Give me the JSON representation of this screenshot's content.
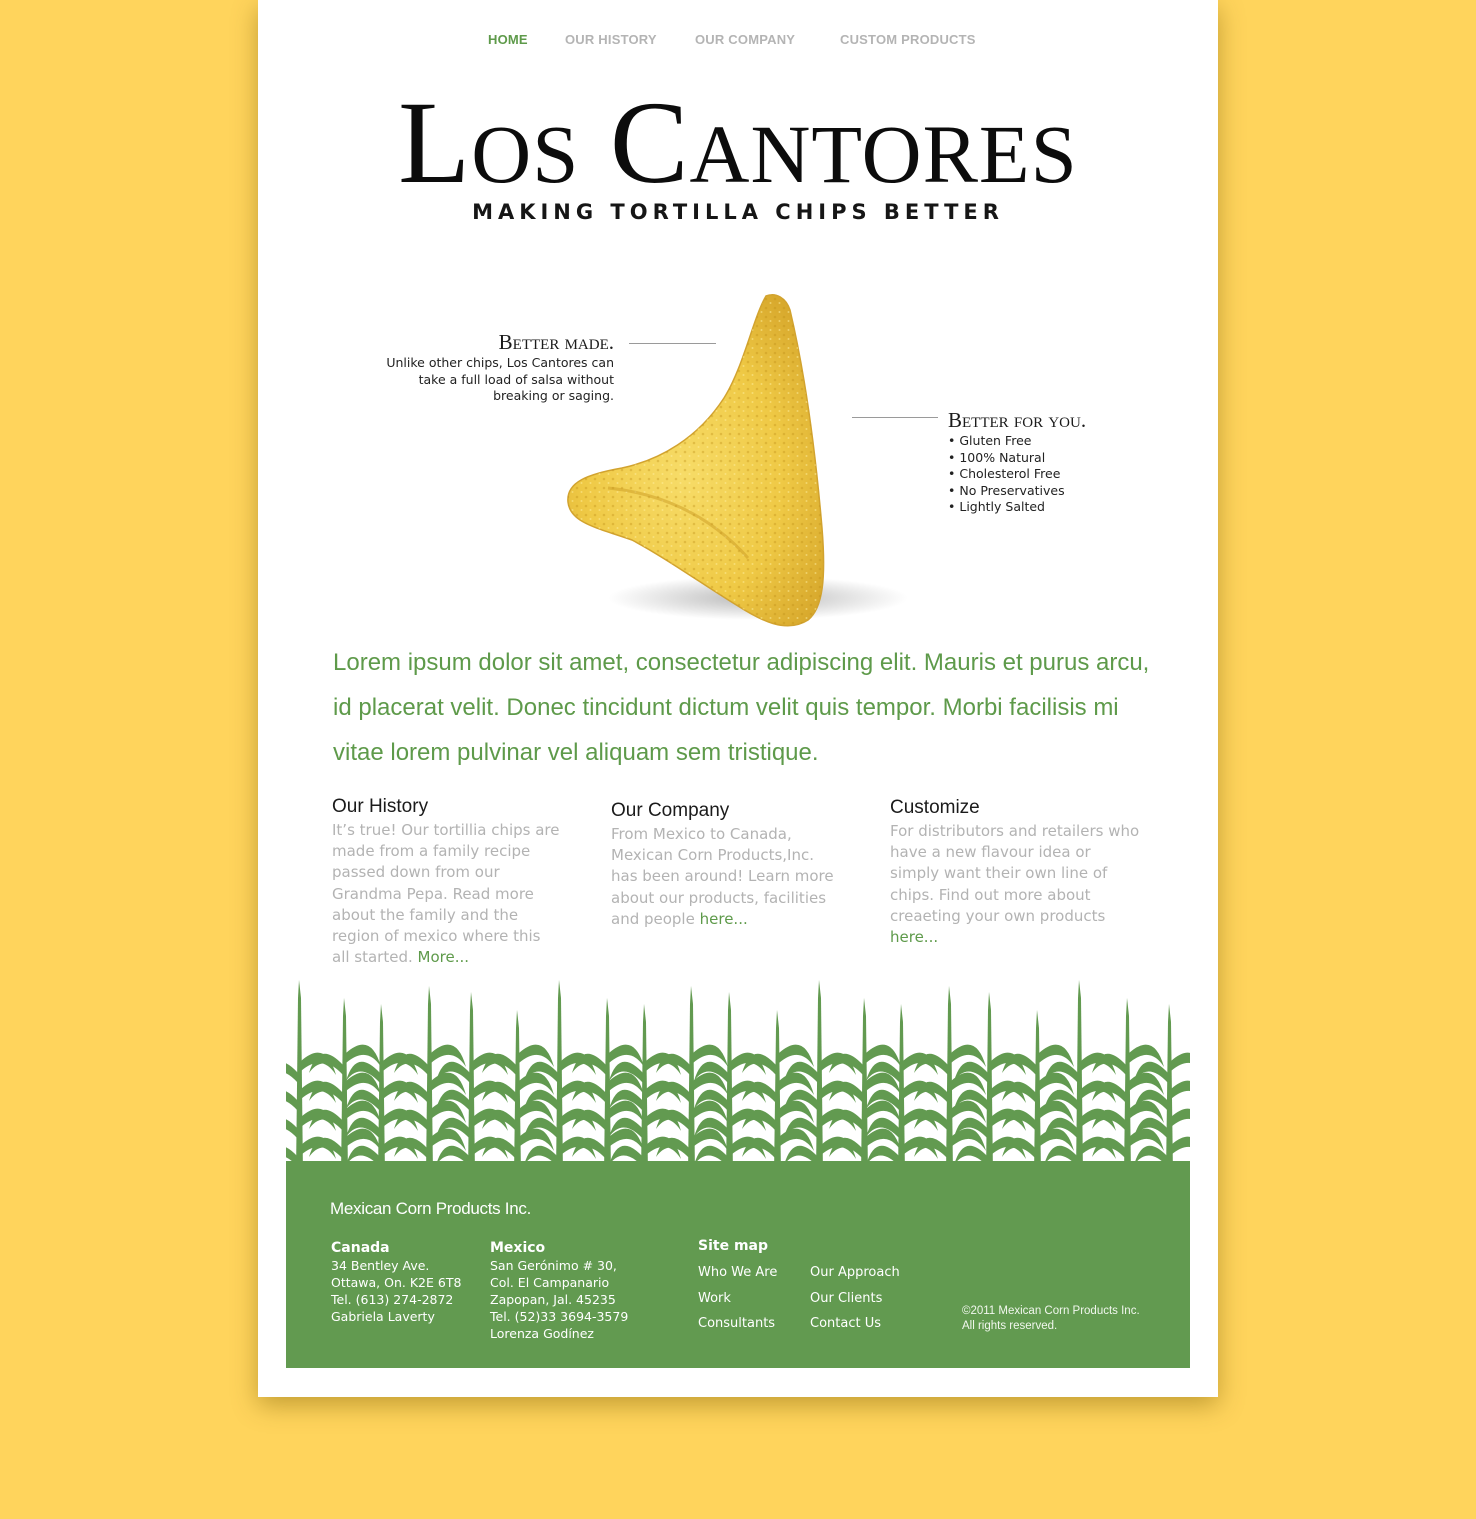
{
  "nav": {
    "home": "HOME",
    "history": "OUR HISTORY",
    "company": "OUR COMPANY",
    "custom": "CUSTOM PRODUCTS",
    "active_color": "#5e9a4a"
  },
  "header": {
    "title": "Los Cantores",
    "tagline": "MAKING TORTILLA CHIPS BETTER"
  },
  "hero": {
    "left_title": "Better made.",
    "left_text": "Unlike other chips, Los Cantores can take a full load of salsa without breaking or saging.",
    "right_title": "Better for you.",
    "benefits": [
      "Gluten Free",
      "100% Natural",
      "Cholesterol Free",
      "No Preservatives",
      "Lightly Salted"
    ]
  },
  "lead": "Lorem ipsum dolor sit amet, consectetur adipiscing elit. Mauris et purus arcu, id placerat velit. Donec tincidunt dictum velit quis tempor. Morbi facilisis mi vitae lorem pulvinar vel aliquam sem tristique.",
  "columns": [
    {
      "title": "Our History",
      "text": "It’s true! Our tortillia chips are made from a family recipe passed down from our Grandma Pepa. Read more about the family and the region of mexico where this all started.",
      "link": "More..."
    },
    {
      "title": "Our Company",
      "text": "From Mexico to Canada, Mexican Corn Products,Inc. has been around! Learn more about our products, facilities and people",
      "link": "here..."
    },
    {
      "title": "Customize",
      "text": "For distributors and retailers who have a new flavour idea or simply want their own line of chips. Find out more about creaeting your own products",
      "link": "here..."
    }
  ],
  "footer": {
    "brand": "Mexican Corn Products Inc.",
    "canada": {
      "heading": "Canada",
      "lines": [
        "34 Bentley Ave.",
        "Ottawa, On. K2E 6T8",
        "Tel. (613) 274-2872",
        "Gabriela Laverty"
      ]
    },
    "mexico": {
      "heading": "Mexico",
      "lines": [
        "San Gerónimo # 30,",
        "Col. El Campanario",
        "Zapopan, Jal. 45235",
        "Tel. (52)33 3694-3579",
        "Lorenza Godínez"
      ]
    },
    "sitemap_heading": "Site map",
    "sitemap": [
      "Who We Are",
      "Work",
      "Consultants",
      "Our Approach",
      "Our Clients",
      "Contact Us"
    ],
    "copyright": [
      "©2011 Mexican Corn Products Inc.",
      "All rights reserved."
    ]
  },
  "colors": {
    "background": "#FFD45C",
    "green": "#629a50",
    "text_green": "#5e9a4a",
    "chip": "#f3cf4e"
  }
}
